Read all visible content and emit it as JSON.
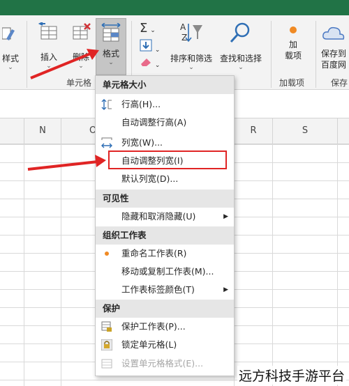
{
  "ribbon": {
    "style_label": "样式",
    "insert_label": "插入",
    "delete_label": "删除",
    "format_label": "格式",
    "cells_group_label": "单元格",
    "sort_filter_label": "排序和筛选",
    "find_select_label": "查找和选择",
    "addins_label": "加载项",
    "addins_top": "加",
    "addins_bottom": "载项",
    "addins_group_label": "加载项",
    "baidu_top": "保存到",
    "baidu_bottom": "百度网",
    "save_group_label": "保存",
    "sigma": "Σ",
    "az_sort": "A Z"
  },
  "columns": [
    "N",
    "O",
    "R",
    "S"
  ],
  "menu": {
    "section_cell_size": "单元格大小",
    "row_height": "行高(H)...",
    "autofit_row": "自动调整行高(A)",
    "column_width": "列宽(W)...",
    "autofit_column": "自动调整列宽(I)",
    "default_width": "默认列宽(D)...",
    "section_visibility": "可见性",
    "hide_unhide": "隐藏和取消隐藏(U)",
    "section_organize": "组织工作表",
    "rename_sheet": "重命名工作表(R)",
    "move_copy_sheet": "移动或复制工作表(M)...",
    "tab_color": "工作表标签颜色(T)",
    "section_protect": "保护",
    "protect_sheet": "保护工作表(P)...",
    "lock_cell": "锁定单元格(L)",
    "format_cells": "设置单元格格式(E)..."
  },
  "watermark": "远方科技手游平台",
  "colors": {
    "excel_green": "#217346",
    "highlight_red": "#e02424",
    "arrow_red": "#e02424"
  }
}
